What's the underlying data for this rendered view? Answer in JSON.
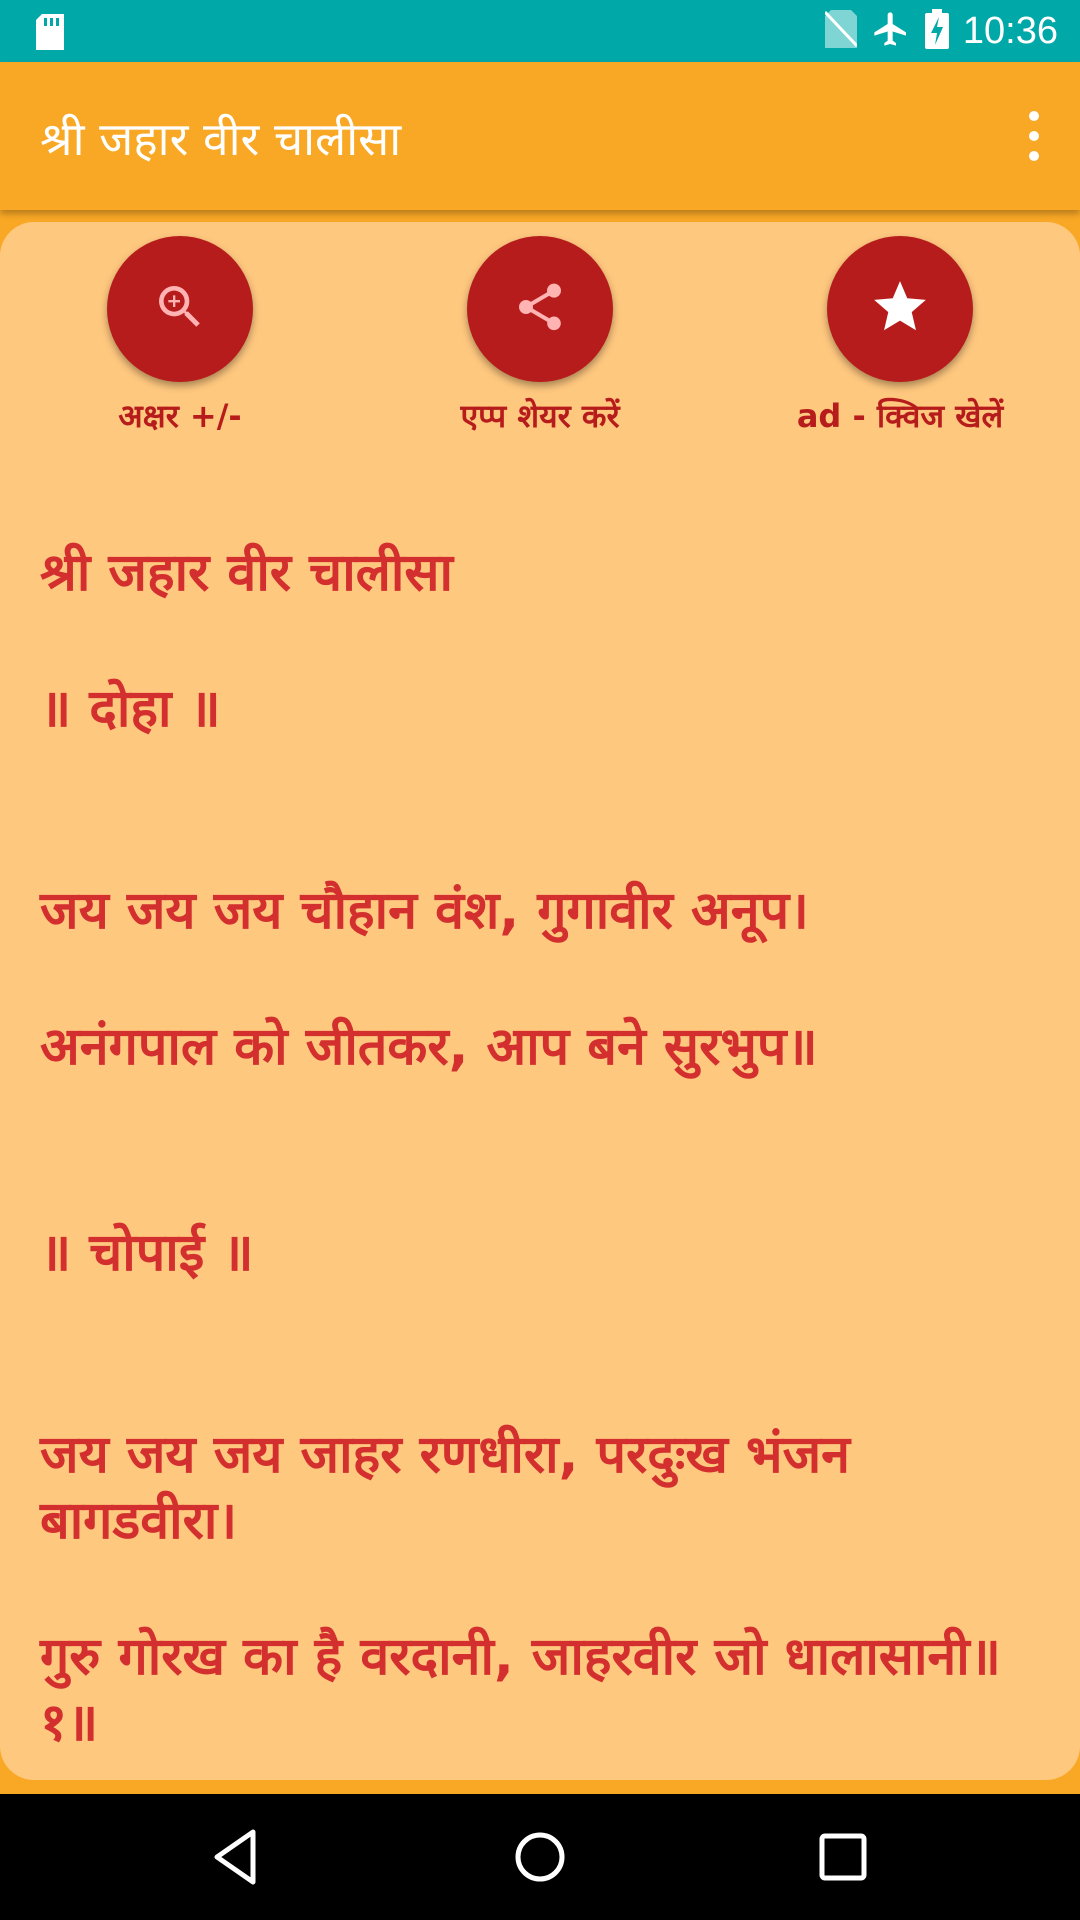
{
  "status_bar": {
    "time": "10:36",
    "icons": [
      "sd-card-icon",
      "no-sim-icon",
      "airplane-mode-icon",
      "battery-charging-icon"
    ]
  },
  "app_bar": {
    "title": "श्री जहार वीर चालीसा",
    "menu_icon": "more-vert-icon"
  },
  "actions": [
    {
      "label": "अक्षर +/-",
      "icon": "zoom-in-icon"
    },
    {
      "label": "एप्प शेयर करें",
      "icon": "share-icon"
    },
    {
      "label": "ad - क्विज खेलें",
      "icon": "star-icon"
    }
  ],
  "content": {
    "title": "श्री जहार वीर चालीसा",
    "doha_heading": "॥ दोहा ॥",
    "doha_line1": "जय जय जय चौहान वंश, गुगावीर अनूप।",
    "doha_line2": "अनंगपाल को जीतकर, आप बने सुरभुप॥",
    "chopai_heading": "॥ चोपाई ॥",
    "chopai_line1": "जय जय जय जाहर रणधीरा, परदुःख भंजन बागडवीरा।",
    "chopai_line2": "गुरु गोरख का है वरदानी, जाहरवीर जो धालासानी॥ १॥"
  },
  "colors": {
    "status_bar": "#00a8a8",
    "app_bar": "#f9a825",
    "card_background": "#ffc87f",
    "button_red": "#b71c1c",
    "text_red": "#d32f2f"
  }
}
